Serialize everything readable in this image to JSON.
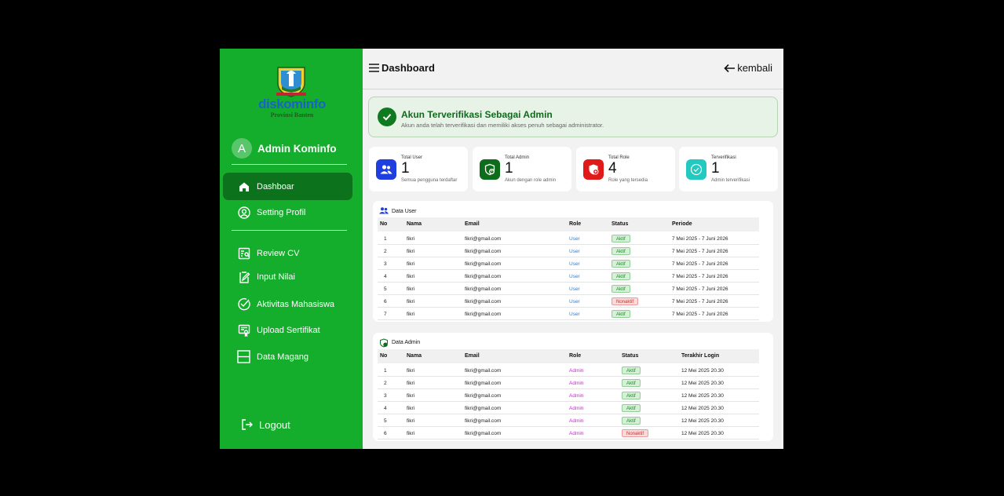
{
  "sidebar": {
    "logo": {
      "brand": "diskominfo",
      "sub": "Provinsi Banten"
    },
    "user": {
      "initial": "A",
      "name": "Admin Kominfo"
    },
    "items": [
      {
        "label": "Dashboar",
        "icon": "home-icon"
      },
      {
        "label": "Setting Profil",
        "icon": "profile-icon"
      },
      {
        "label": "Review CV",
        "icon": "review-icon"
      },
      {
        "label": "Input Nilai",
        "icon": "clipboard-pen-icon"
      },
      {
        "label": "Aktivitas Mahasiswa",
        "icon": "check-circle-icon"
      },
      {
        "label": "Upload Sertifikat",
        "icon": "certificate-icon"
      },
      {
        "label": "Data Magang",
        "icon": "layout-icon"
      }
    ],
    "logout_label": "Logout"
  },
  "header": {
    "title": "Dashboard",
    "back_label": "kembali"
  },
  "banner": {
    "title": "Akun Terverifikasi Sebagai Admin",
    "text": "Akun anda telah terverifikasi dan memiliki akses penuh sebagai administrator."
  },
  "stats": [
    {
      "label": "Total User",
      "value": "1",
      "desc": "Semua pengguna terdaftar",
      "color": "#1f3ee0",
      "icon": "users-icon"
    },
    {
      "label": "Total Admin",
      "value": "1",
      "desc": "Akun dengan role admin",
      "color": "#0e6d1b",
      "icon": "shield-user-icon"
    },
    {
      "label": "Total Role",
      "value": "4",
      "desc": "Role yang tersedia",
      "color": "#e01919",
      "icon": "shield-plus-icon"
    },
    {
      "label": "Terverifikasi",
      "value": "1",
      "desc": "Admin terverifikasi",
      "color": "#22c9c1",
      "icon": "verified-icon"
    }
  ],
  "users_table": {
    "title": "Data User",
    "columns": [
      "No",
      "Nama",
      "Email",
      "Role",
      "Status",
      "Periode"
    ],
    "rows": [
      [
        "1",
        "fikri",
        "fikri@gmail.com",
        "User",
        "Aktif",
        "7 Mei 2025 - 7 Juni 2026"
      ],
      [
        "2",
        "fikri",
        "fikri@gmail.com",
        "User",
        "Aktif",
        "7 Mei 2025 - 7 Juni 2026"
      ],
      [
        "3",
        "fikri",
        "fikri@gmail.com",
        "User",
        "Aktif",
        "7 Mei 2025 - 7 Juni 2026"
      ],
      [
        "4",
        "fikri",
        "fikri@gmail.com",
        "User",
        "Aktif",
        "7 Mei 2025 - 7 Juni 2026"
      ],
      [
        "5",
        "fikri",
        "fikri@gmail.com",
        "User",
        "Aktif",
        "7 Mei 2025 - 7 Juni 2026"
      ],
      [
        "6",
        "fikri",
        "fikri@gmail.com",
        "User",
        "Nonaktif",
        "7 Mei 2025 - 7 Juni 2026"
      ],
      [
        "7",
        "fikri",
        "fikri@gmail.com",
        "User",
        "Aktif",
        "7 Mei 2025 - 7 Juni 2026"
      ]
    ]
  },
  "admins_table": {
    "title": "Data Admin",
    "columns": [
      "No",
      "Nama",
      "Email",
      "Role",
      "Status",
      "Terakhir Login"
    ],
    "rows": [
      [
        "1",
        "fikri",
        "fikri@gmail.com",
        "Admin",
        "Aktif",
        "12 Mei 2025 20.30"
      ],
      [
        "2",
        "fikri",
        "fikri@gmail.com",
        "Admin",
        "Aktif",
        "12 Mei 2025 20.30"
      ],
      [
        "3",
        "fikri",
        "fikri@gmail.com",
        "Admin",
        "Aktif",
        "12 Mei 2025 20.30"
      ],
      [
        "4",
        "fikri",
        "fikri@gmail.com",
        "Admin",
        "Aktif",
        "12 Mei 2025 20.30"
      ],
      [
        "5",
        "fikri",
        "fikri@gmail.com",
        "Admin",
        "Aktif",
        "12 Mei 2025 20.30"
      ],
      [
        "6",
        "fikri",
        "fikri@gmail.com",
        "Admin",
        "Nonaktif",
        "12 Mei 2025 20.30"
      ]
    ]
  },
  "colors": {
    "sidebar": "#14ae2c",
    "sidebar_active": "#0c731c",
    "status_active": "#1d8a2a",
    "status_inactive": "#c9302c"
  }
}
